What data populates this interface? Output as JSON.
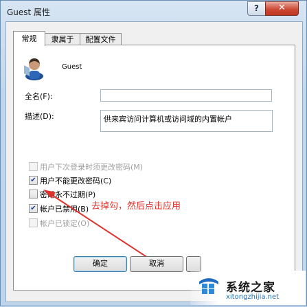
{
  "window": {
    "title": "Guest 属性",
    "help_glyph": "?",
    "close_glyph": "✕"
  },
  "tabs": [
    {
      "label": "常规",
      "active": true
    },
    {
      "label": "隶属于",
      "active": false
    },
    {
      "label": "配置文件",
      "active": false
    }
  ],
  "user": {
    "name": "Guest",
    "icon": "user-avatar-icon"
  },
  "fields": {
    "fullname_label": "全名(F):",
    "fullname_value": "",
    "description_label": "描述(D):",
    "description_value": "供来宾访问计算机或访问域的内置帐户"
  },
  "checkboxes": [
    {
      "label": "用户下次登录时须更改密码(M)",
      "checked": false,
      "disabled": true
    },
    {
      "label": "用户不能更改密码(C)",
      "checked": true,
      "disabled": false
    },
    {
      "label": "密码永不过期(P)",
      "checked": false,
      "disabled": false
    },
    {
      "label": "帐户已禁用(B)",
      "checked": true,
      "disabled": false
    },
    {
      "label": "帐户已锁定(O)",
      "checked": false,
      "disabled": true
    }
  ],
  "annotation": {
    "text": "去掉勾，然后点击应用",
    "color": "#e0322a"
  },
  "buttons": {
    "ok": "确定",
    "cancel": "取消"
  },
  "watermark": {
    "text": "系统之家",
    "url": "xitongzhijia.net"
  },
  "colors": {
    "accent": "#3c7fb1",
    "annotation": "#e0322a",
    "close": "#c0341f"
  }
}
